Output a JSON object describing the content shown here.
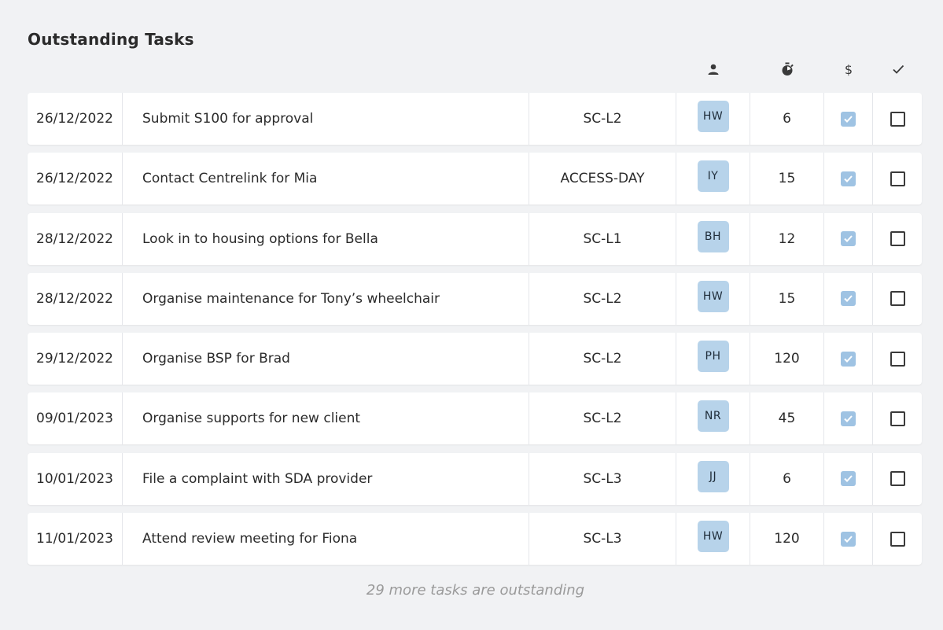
{
  "title": "Outstanding Tasks",
  "header_icons": {
    "assignee": "person-icon",
    "duration": "timer-icon",
    "billable": "$",
    "complete": "check-icon"
  },
  "colors": {
    "background": "#f1f2f4",
    "avatar": "#b7d3ea",
    "checked": "#9fc3e3"
  },
  "tasks": [
    {
      "date": "26/12/2022",
      "task": "Submit S100 for approval",
      "code": "SC-L2",
      "assignee": "HW",
      "minutes": "6",
      "billable": true,
      "complete": false
    },
    {
      "date": "26/12/2022",
      "task": "Contact Centrelink for Mia",
      "code": "ACCESS-DAY",
      "assignee": "IY",
      "minutes": "15",
      "billable": true,
      "complete": false
    },
    {
      "date": "28/12/2022",
      "task": "Look in to housing options for Bella",
      "code": "SC-L1",
      "assignee": "BH",
      "minutes": "12",
      "billable": true,
      "complete": false
    },
    {
      "date": "28/12/2022",
      "task": "Organise maintenance for Tony’s wheelchair",
      "code": "SC-L2",
      "assignee": "HW",
      "minutes": "15",
      "billable": true,
      "complete": false
    },
    {
      "date": "29/12/2022",
      "task": "Organise BSP for Brad",
      "code": "SC-L2",
      "assignee": "PH",
      "minutes": "120",
      "billable": true,
      "complete": false
    },
    {
      "date": "09/01/2023",
      "task": "Organise supports for new client",
      "code": "SC-L2",
      "assignee": "NR",
      "minutes": "45",
      "billable": true,
      "complete": false
    },
    {
      "date": "10/01/2023",
      "task": "File a complaint with SDA provider",
      "code": "SC-L3",
      "assignee": "JJ",
      "minutes": "6",
      "billable": true,
      "complete": false
    },
    {
      "date": "11/01/2023",
      "task": "Attend review meeting for Fiona",
      "code": "SC-L3",
      "assignee": "HW",
      "minutes": "120",
      "billable": true,
      "complete": false
    }
  ],
  "footer": "29 more tasks are outstanding"
}
